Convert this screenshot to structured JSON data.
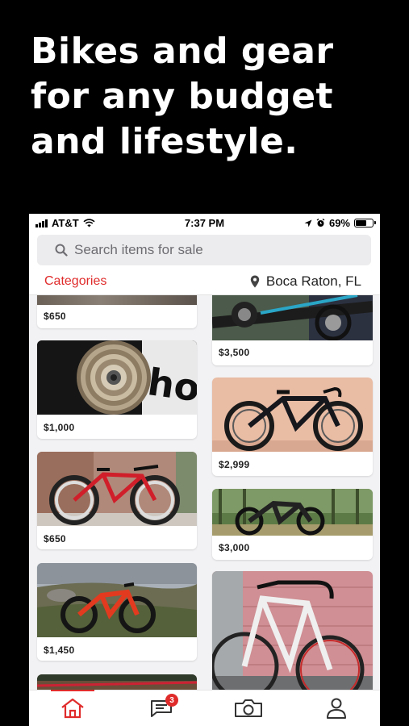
{
  "headline": {
    "line1": "Bikes and gear",
    "line2": "for any budget",
    "line3": "and lifestyle."
  },
  "status_bar": {
    "carrier": "AT&T",
    "time": "7:37 PM",
    "battery": "69%",
    "battery_level": 0.69
  },
  "search": {
    "placeholder": "Search items for sale"
  },
  "filters": {
    "categories_label": "Categories",
    "location": "Boca Raton, FL"
  },
  "listings": {
    "left": [
      {
        "price": "$650",
        "image": "partial-item-photo"
      },
      {
        "price": "$1,000",
        "image": "cassette-sprocket-photo"
      },
      {
        "price": "$650",
        "image": "red-triathlon-bike-photo"
      },
      {
        "price": "$1,450",
        "image": "red-mountain-bike-on-hillside-photo"
      },
      {
        "price": "",
        "image": "partial-item-photo"
      }
    ],
    "right": [
      {
        "price": "$3,500",
        "image": "road-bike-drivetrain-photo"
      },
      {
        "price": "$2,999",
        "image": "black-road-bike-photo"
      },
      {
        "price": "$3,000",
        "image": "mountain-bike-in-forest-photo"
      },
      {
        "price": "",
        "image": "white-road-bike-against-wall-photo"
      }
    ]
  },
  "tab_bar": {
    "tabs": [
      "home-icon",
      "messages-icon",
      "camera-icon",
      "profile-icon"
    ],
    "messages_badge": "3",
    "active_tab": "home-icon"
  },
  "colors": {
    "accent": "#e02b2b",
    "background": "#000000",
    "feed_background": "#f2f2f4"
  }
}
